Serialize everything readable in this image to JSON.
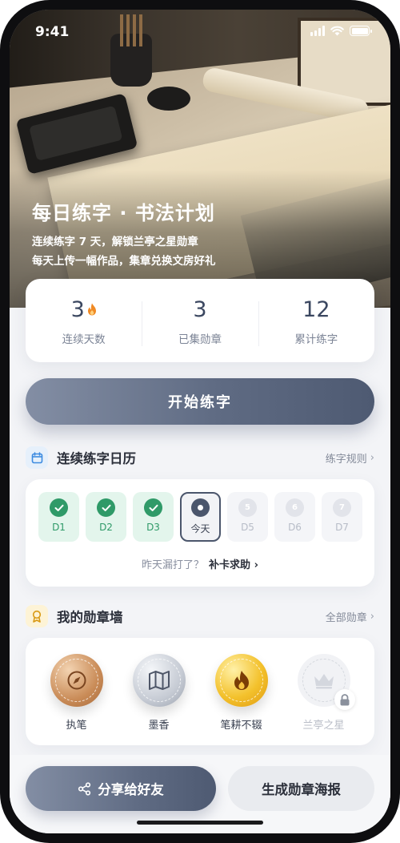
{
  "status_bar": {
    "time": "9:41"
  },
  "hero": {
    "title": "每日练字 · 书法计划",
    "subtitle_1": "连续练字 7 天，解锁兰亭之星勋章",
    "subtitle_2": "每天上传一幅作品，集章兑换文房好礼"
  },
  "stats": [
    {
      "value": "3",
      "label": "连续天数",
      "icon": "flame-icon"
    },
    {
      "value": "3",
      "label": "已集勋章"
    },
    {
      "value": "12",
      "label": "累计练字"
    }
  ],
  "start_button": "开始练字",
  "calendar": {
    "title": "连续练字日历",
    "link": "练字规则",
    "days": [
      {
        "label": "D1",
        "state": "done"
      },
      {
        "label": "D2",
        "state": "done"
      },
      {
        "label": "D3",
        "state": "done"
      },
      {
        "label": "今天",
        "state": "today"
      },
      {
        "label": "D5",
        "num": "5",
        "state": "future"
      },
      {
        "label": "D6",
        "num": "6",
        "state": "future"
      },
      {
        "label": "D7",
        "num": "7",
        "state": "future"
      }
    ],
    "makeup_question": "昨天漏打了？",
    "makeup_action": "补卡求助"
  },
  "badges": {
    "title": "我的勋章墙",
    "link": "全部勋章",
    "items": [
      {
        "name": "执笔",
        "icon": "compass-icon",
        "tier": "bronze"
      },
      {
        "name": "墨香",
        "icon": "map-icon",
        "tier": "silver"
      },
      {
        "name": "笔耕不辍",
        "icon": "flame-icon",
        "tier": "gold"
      },
      {
        "name": "兰亭之星",
        "icon": "crown-icon",
        "tier": "locked"
      }
    ]
  },
  "bottom": {
    "share_label": "分享给好友",
    "poster_label": "生成勋章海报"
  },
  "colors": {
    "accent": "#5f6b83",
    "success": "#2f9a68",
    "flame": "#f08a24"
  }
}
